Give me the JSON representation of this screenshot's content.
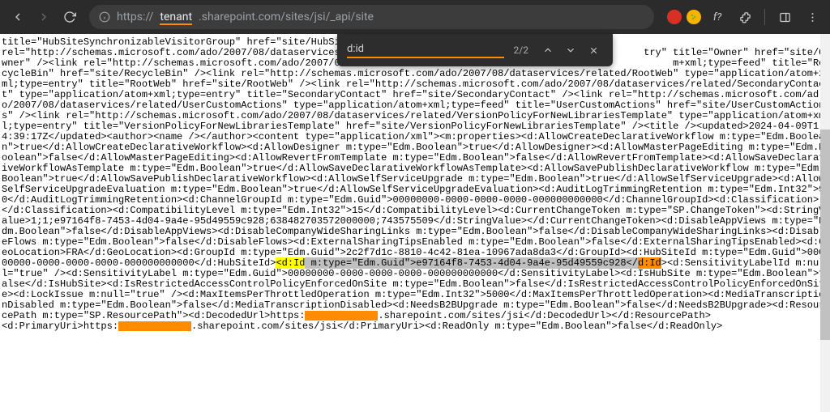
{
  "browser": {
    "url_proto": "https://",
    "url_host": "tenant",
    "url_rest": ".sharepoint.com/sites/jsi/_api/site"
  },
  "find": {
    "term": "d:id",
    "count": "2/2"
  },
  "xml": {
    "pre": "title=\"HubSiteSynchronizableVisitorGroup\" href=\"site/HubSit\nrel=\"http://schemas.microsoft.com/ado/2007/08/dataservices/                                                   try\" title=\"Owner\" href=\"site/Owner\" /><link rel=\"http://schemas.microsoft.com/ado/2007/08/data                                                   m+xml;type=feed\" title=\"RecycleBin\" href=\"site/RecycleBin\" /><link rel=\"http://schemas.microsoft.com/ado/2007/08/dataservices/related/RootWeb\" type=\"application/atom+xml;type=entry\" title=\"RootWeb\" href=\"site/RootWeb\" /><link rel=\"http://schemas.microsoft.com/ado/2007/08/dataservices/related/SecondaryContact\" type=\"application/atom+xml;type=entry\" title=\"SecondaryContact\" href=\"site/SecondaryContact\" /><link rel=\"http://schemas.microsoft.com/ado/2007/08/dataservices/related/UserCustomActions\" type=\"application/atom+xml;type=feed\" title=\"UserCustomActions\" href=\"site/UserCustomActions\" /><link rel=\"http://schemas.microsoft.com/ado/2007/08/dataservices/related/VersionPolicyForNewLibrariesTemplate\" type=\"application/atom+xml;type=entry\" title=\"VersionPolicyForNewLibrariesTemplate\" href=\"site/VersionPolicyForNewLibrariesTemplate\" /><title /><updated>2024-04-09T14:39:17Z</updated><author><name /></author><content type=\"application/xml\"><m:properties><d:AllowCreateDeclarativeWorkflow m:type=\"Edm.Boolean\">true</d:AllowCreateDeclarativeWorkflow><d:AllowDesigner m:type=\"Edm.Boolean\">true</d:AllowDesigner><d:AllowMasterPageEditing m:type=\"Edm.Boolean\">false</d:AllowMasterPageEditing><d:AllowRevertFromTemplate m:type=\"Edm.Boolean\">false</d:AllowRevertFromTemplate><d:AllowSaveDeclarativeWorkflowAsTemplate m:type=\"Edm.Boolean\">true</d:AllowSaveDeclarativeWorkflowAsTemplate><d:AllowSavePublishDeclarativeWorkflow m:type=\"Edm.Boolean\">true</d:AllowSavePublishDeclarativeWorkflow><d:AllowSelfServiceUpgrade m:type=\"Edm.Boolean\">true</d:AllowSelfServiceUpgrade><d:AllowSelfServiceUpgradeEvaluation m:type=\"Edm.Boolean\">true</d:AllowSelfServiceUpgradeEvaluation><d:AuditLogTrimmingRetention m:type=\"Edm.Int32\">90</d:AuditLogTrimmingRetention><d:ChannelGroupId m:type=\"Edm.Guid\">00000000-0000-0000-0000-000000000000</d:ChannelGroupId><d:Classification></d:Classification><d:CompatibilityLevel m:type=\"Edm.Int32\">15</d:CompatibilityLevel><d:CurrentChangeToken m:type=\"SP.ChangeToken\"><d:StringValue>1;1;e97164f8-7453-4d04-9a4e-95d49559c928;638482703572000000;743575509</d:StringValue></d:CurrentChangeToken><d:DisableAppViews m:type=\"Edm.Boolean\">false</d:DisableAppViews><d:DisableCompanyWideSharingLinks m:type=\"Edm.Boolean\">false</d:DisableCompanyWideSharingLinks><d:DisableFlows m:type=\"Edm.Boolean\">false</d:DisableFlows><d:ExternalSharingTipsEnabled m:type=\"Edm.Boolean\">false</d:ExternalSharingTipsEnabled><d:GeoLocation>FRA</d:GeoLocation><d:GroupId m:type=\"Edm.Guid\">2c2f7d1c-8810-4c42-81ea-10967ada8da3</d:GroupId><d:HubSiteId m:type=\"Edm.Guid\">00000000-0000-0000-0000-000000000000</d:HubSiteId>",
    "open_id_tag": "<d:Id",
    "open_id_rest": " m:type=\"Edm.Guid\">e97164f8-7453-4d04-9a4e-95d49559c928</",
    "close_id": "d:Id",
    "post": "><d:SensitivityLabelId m:null=\"true\" /><d:SensitivityLabel m:type=\"Edm.Guid\">00000000-0000-0000-0000-000000000000</d:SensitivityLabel><d:IsHubSite m:type=\"Edm.Boolean\">false</d:IsHubSite><d:IsRestrictedAccessControlPolicyEnforcedOnSite m:type=\"Edm.Boolean\">false</d:IsRestrictedAccessControlPolicyEnforcedOnSite><d:LockIssue m:null=\"true\" /><d:MaxItemsPerThrottledOperation m:type=\"Edm.Int32\">5000</d:MaxItemsPerThrottledOperation><d:MediaTranscriptionDisabled m:type=\"Edm.Boolean\">false</d:MediaTranscriptionDisabled><d:NeedsB2BUpgrade m:type=\"Edm.Boolean\">false</d:NeedsB2BUpgrade><d:ResourcePath m:type=\"SP.ResourcePath\"><d:DecodedUrl>https:",
    "decoded_suffix": ".sharepoint.com/sites/jsi</d:DecodedUrl></d:ResourcePath>",
    "primary": "<d:PrimaryUri>https:",
    "primary_suffix": ".sharepoint.com/sites/jsi</d:PrimaryUri><d:ReadOnly m:type=\"Edm.Boolean\">false</d:ReadOnly>"
  }
}
